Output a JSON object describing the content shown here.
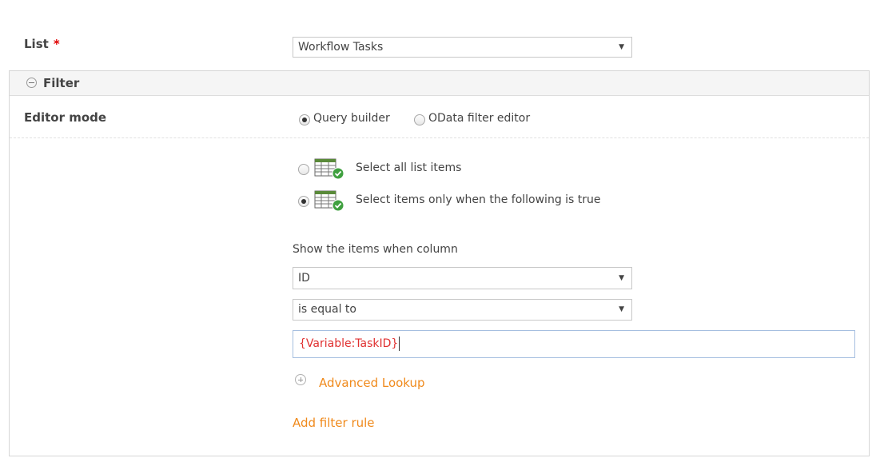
{
  "list": {
    "label": "List",
    "required_mark": "*",
    "selected": "Workflow Tasks"
  },
  "filter": {
    "title": "Filter",
    "editor_mode_label": "Editor mode",
    "modes": [
      {
        "label": "Query builder",
        "checked": true
      },
      {
        "label": "OData filter editor",
        "checked": false
      }
    ],
    "options": [
      {
        "label": "Select all list items",
        "checked": false
      },
      {
        "label": "Select items only when the following is true",
        "checked": true
      }
    ],
    "show_items_label": "Show the items when column",
    "column_selected": "ID",
    "operator_selected": "is equal to",
    "value": "{Variable:TaskID}",
    "advanced_lookup": "Advanced Lookup",
    "add_filter_rule": "Add filter rule"
  },
  "colors": {
    "accent_link": "#f08a1c",
    "required": "#e00000",
    "token_text": "#e03030"
  },
  "icons": [
    "caret-down-icon",
    "collapse-icon",
    "list-check-icon",
    "expand-plus-icon"
  ]
}
